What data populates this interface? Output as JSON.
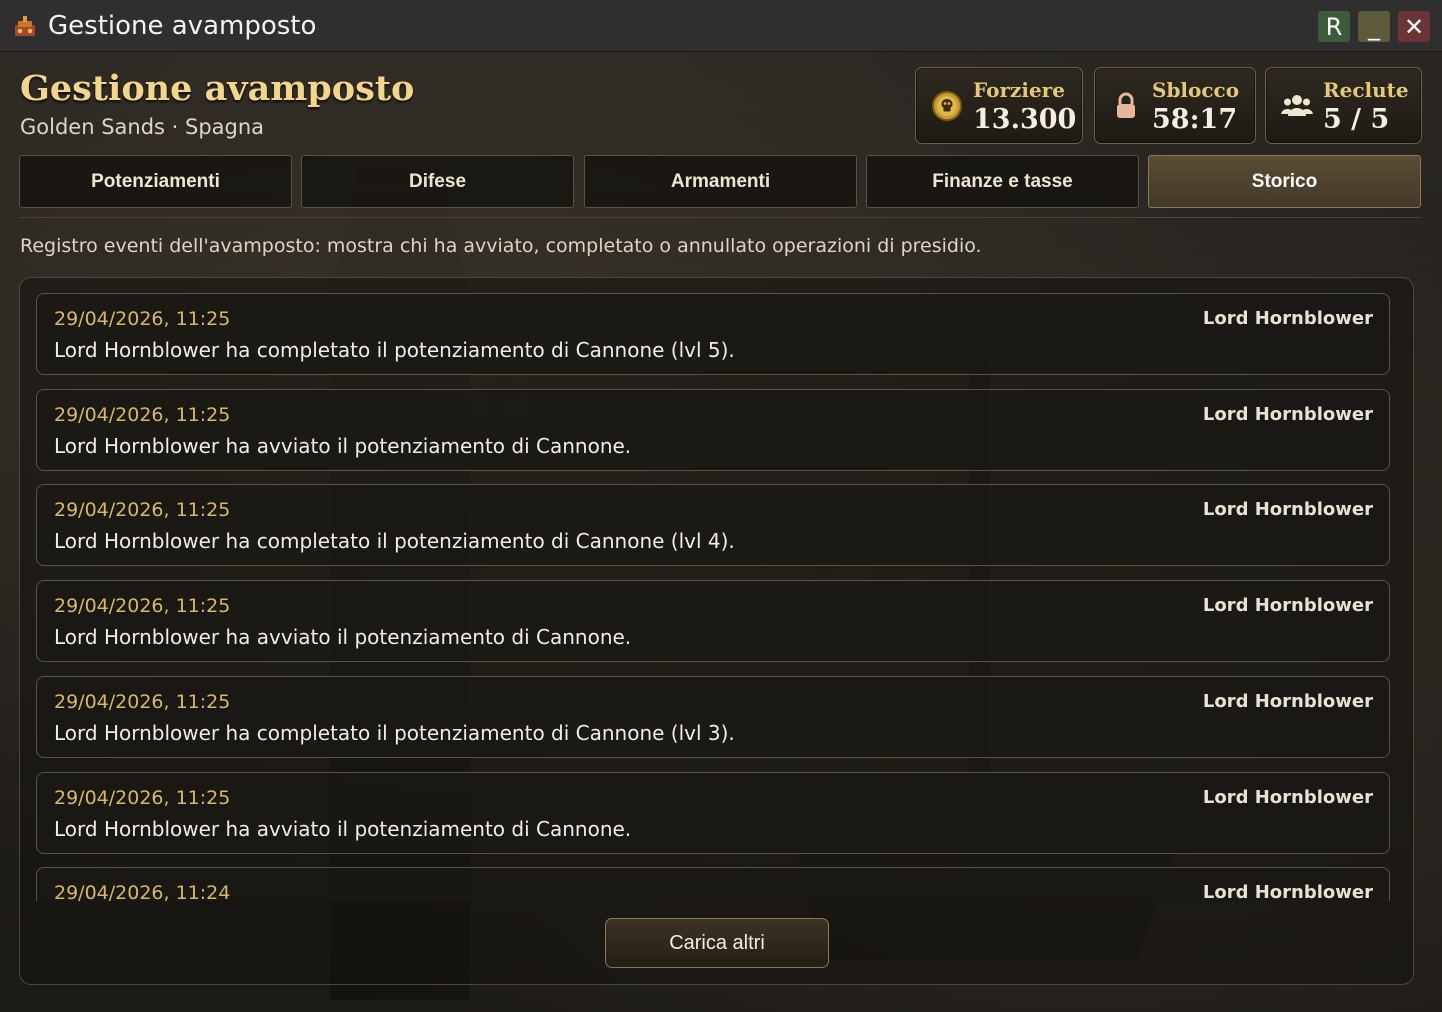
{
  "window": {
    "title": "Gestione avamposto",
    "buttons": {
      "r_label": "R",
      "minimize_label": "_",
      "close_label": "✕"
    }
  },
  "header": {
    "title": "Gestione avamposto",
    "subtitle": "Golden Sands · Spagna"
  },
  "stats": {
    "forziere": {
      "label": "Forziere",
      "value": "13.300",
      "icon": "skull-coin-icon"
    },
    "sblocco": {
      "label": "Sblocco",
      "value": "58:17",
      "icon": "lock-icon"
    },
    "reclute": {
      "label": "Reclute",
      "value": "5 / 5",
      "icon": "users-icon"
    }
  },
  "tabs": [
    {
      "label": "Potenziamenti",
      "active": false
    },
    {
      "label": "Difese",
      "active": false
    },
    {
      "label": "Armamenti",
      "active": false
    },
    {
      "label": "Finanze e tasse",
      "active": false
    },
    {
      "label": "Storico",
      "active": true
    }
  ],
  "description": "Registro eventi dell'avamposto: mostra chi ha avviato, completato o annullato operazioni di presidio.",
  "log": [
    {
      "time": "29/04/2026, 11:25",
      "author": "Lord Hornblower",
      "message": "Lord Hornblower ha completato il potenziamento di Cannone (lvl 5)."
    },
    {
      "time": "29/04/2026, 11:25",
      "author": "Lord Hornblower",
      "message": "Lord Hornblower ha avviato il potenziamento di Cannone."
    },
    {
      "time": "29/04/2026, 11:25",
      "author": "Lord Hornblower",
      "message": "Lord Hornblower ha completato il potenziamento di Cannone (lvl 4)."
    },
    {
      "time": "29/04/2026, 11:25",
      "author": "Lord Hornblower",
      "message": "Lord Hornblower ha avviato il potenziamento di Cannone."
    },
    {
      "time": "29/04/2026, 11:25",
      "author": "Lord Hornblower",
      "message": "Lord Hornblower ha completato il potenziamento di Cannone (lvl 3)."
    },
    {
      "time": "29/04/2026, 11:25",
      "author": "Lord Hornblower",
      "message": "Lord Hornblower ha avviato il potenziamento di Cannone."
    },
    {
      "time": "29/04/2026, 11:24",
      "author": "Lord Hornblower",
      "message": ""
    }
  ],
  "load_more_label": "Carica altri",
  "colors": {
    "accent_gold": "#f3d58c",
    "timestamp": "#d8b766",
    "titlebar": "#2f2f2f"
  }
}
